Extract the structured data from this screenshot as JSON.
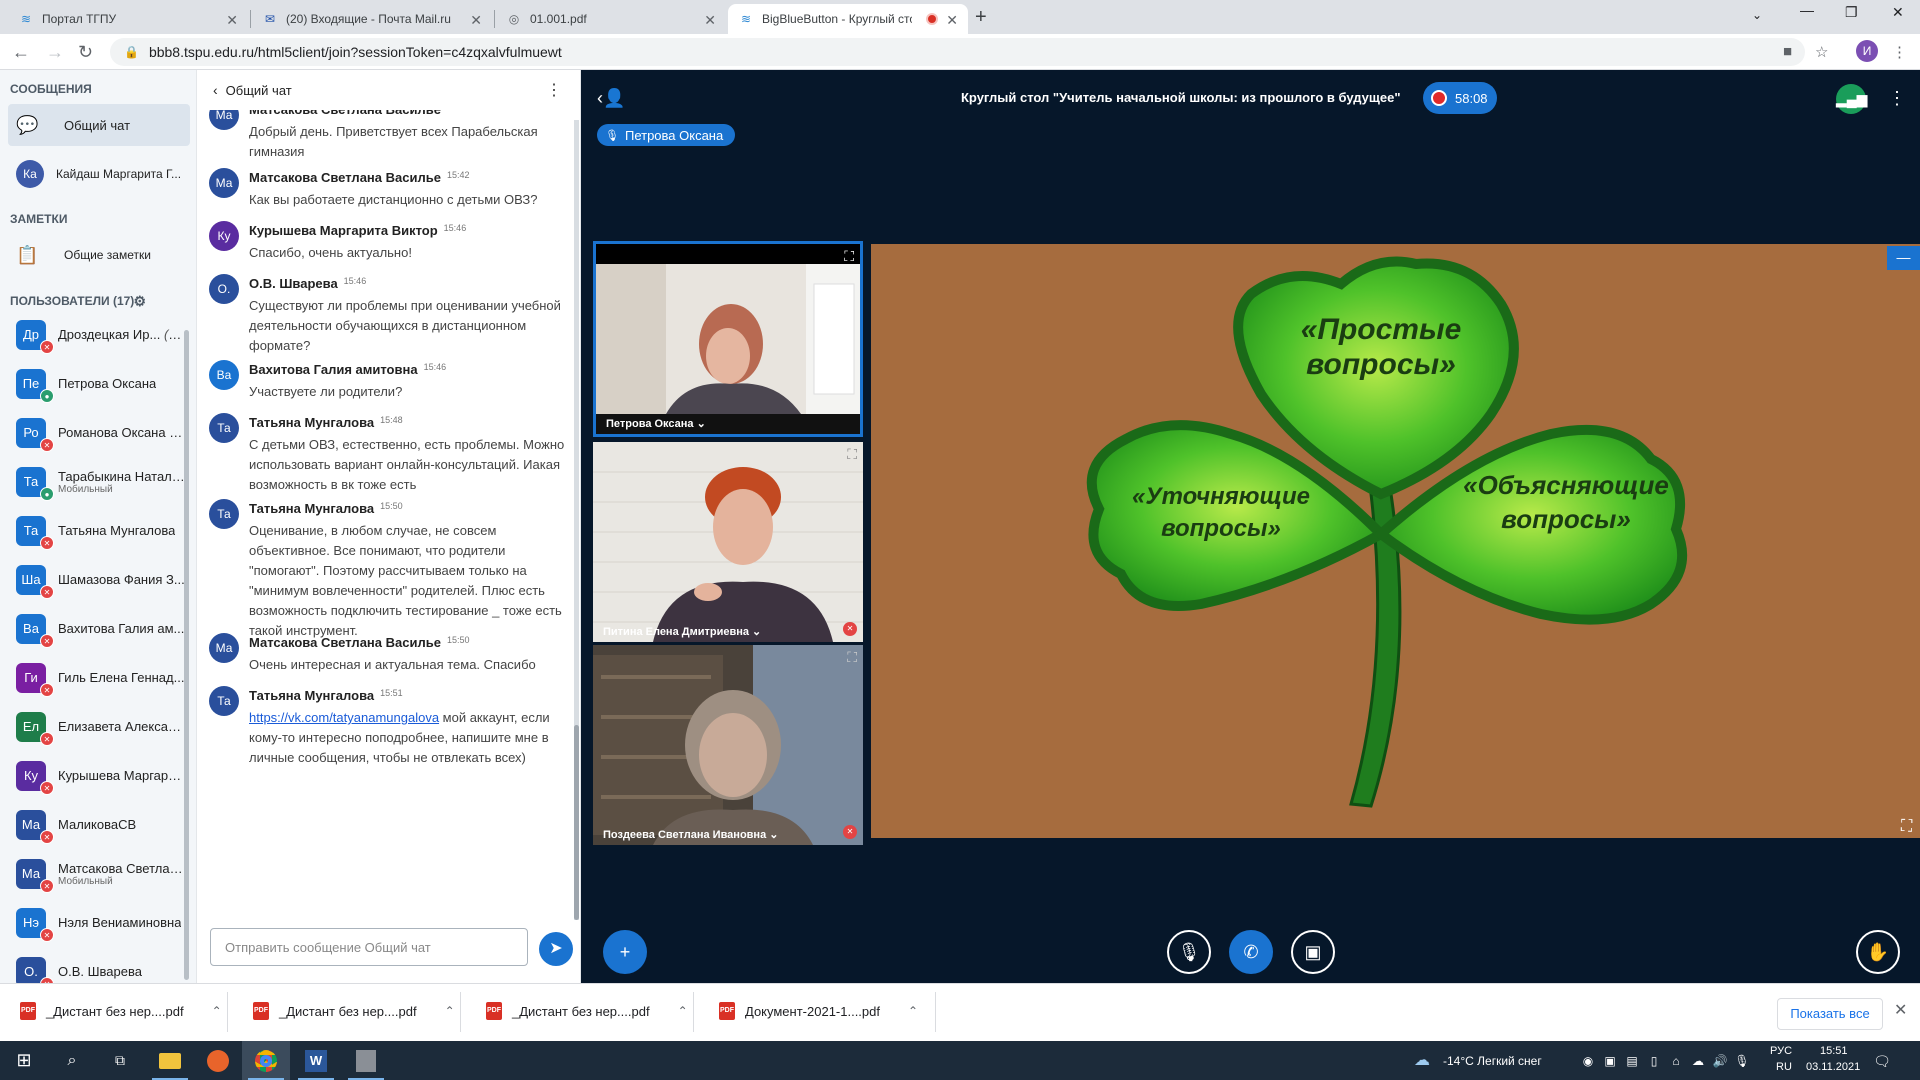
{
  "browser": {
    "tabs": [
      {
        "title": "Портал ТГПУ"
      },
      {
        "title": "(20) Входящие - Почта Mail.ru"
      },
      {
        "title": "01.001.pdf"
      },
      {
        "title": "BigBlueButton - Круглый сто"
      }
    ],
    "url": "bbb8.tspu.edu.ru/html5client/join?sessionToken=c4zqxalvfulmuewt",
    "profile_initial": "И"
  },
  "sidebar": {
    "messages_title": "СООБЩЕНИЯ",
    "public_chat": "Общий чат",
    "private_chat": {
      "initials": "Ка",
      "name": "Кайдаш Маргарита Г..."
    },
    "notes_title": "ЗАМЕТКИ",
    "shared_notes": "Общие заметки",
    "users_title": "ПОЛЬЗОВАТЕЛИ (17)",
    "users": [
      {
        "initials": "Др",
        "name": "Дроздецкая Ир...",
        "you": "(Вы)",
        "sub": "",
        "color": "#1a73d0",
        "mic": "off"
      },
      {
        "initials": "Пе",
        "name": "Петрова Оксана",
        "you": "",
        "sub": "",
        "color": "#1a73d0",
        "mic": "on"
      },
      {
        "initials": "Ро",
        "name": "Романова Оксана Е...",
        "you": "",
        "sub": "",
        "color": "#1a73d0",
        "mic": "off"
      },
      {
        "initials": "Та",
        "name": "Тарабыкина Наталья",
        "you": "",
        "sub": "Мобильный",
        "color": "#1a73d0",
        "mic": "on"
      },
      {
        "initials": "Та",
        "name": "Татьяна Мунгалова",
        "you": "",
        "sub": "",
        "color": "#1a73d0",
        "mic": "off"
      },
      {
        "initials": "Ша",
        "name": "Шамазова Фания З...",
        "you": "",
        "sub": "",
        "color": "#1a73d0",
        "mic": "off"
      },
      {
        "initials": "Ва",
        "name": "Вахитова Галия ам...",
        "you": "",
        "sub": "",
        "color": "#1a73d0",
        "mic": "off"
      },
      {
        "initials": "Ги",
        "name": "Гиль Елена Геннад...",
        "you": "",
        "sub": "",
        "color": "#7a1fa2",
        "mic": "off"
      },
      {
        "initials": "Ел",
        "name": "Елизавета Алексан...",
        "you": "",
        "sub": "",
        "color": "#1e7d4a",
        "mic": "off"
      },
      {
        "initials": "Ку",
        "name": "Курышева Маргари...",
        "you": "",
        "sub": "",
        "color": "#5a2ca0",
        "mic": "off"
      },
      {
        "initials": "Ма",
        "name": "МаликоваСВ",
        "you": "",
        "sub": "",
        "color": "#2a4f9c",
        "mic": "off"
      },
      {
        "initials": "Ма",
        "name": "Матсакова Светлан...",
        "you": "",
        "sub": "Мобильный",
        "color": "#2a4f9c",
        "mic": "off"
      },
      {
        "initials": "Нэ",
        "name": "Нэля Вениаминовна",
        "you": "",
        "sub": "",
        "color": "#1a73d0",
        "mic": "off"
      },
      {
        "initials": "О.",
        "name": "О.В. Шварева",
        "you": "",
        "sub": "",
        "color": "#2a4f9c",
        "mic": "off"
      }
    ]
  },
  "chat": {
    "title": "Общий чат",
    "messages": [
      {
        "initials": "Ма",
        "name": "Матсакова Светлана Василье",
        "time": "",
        "text": "Добрый день. Приветствует всех Парабельская гимназия",
        "link": "",
        "color": "#2a4f9c"
      },
      {
        "initials": "Ма",
        "name": "Матсакова Светлана Василье",
        "time": "15:42",
        "text": "Как вы работаете дистанционно с детьми ОВЗ?",
        "link": "",
        "color": "#2a4f9c"
      },
      {
        "initials": "Ку",
        "name": "Курышева Маргарита Виктор",
        "time": "15:46",
        "text": "Спасибо, очень актуально!",
        "link": "",
        "color": "#5a2ca0"
      },
      {
        "initials": "О.",
        "name": "О.В. Шварева",
        "time": "15:46",
        "text": "Существуют ли проблемы при оценивании учебной деятельности обучающихся в дистанционном формате?",
        "link": "",
        "color": "#2a4f9c"
      },
      {
        "initials": "Ва",
        "name": "Вахитова Галия амитовна",
        "time": "15:46",
        "text": "Участвуете ли родители?",
        "link": "",
        "color": "#1a73d0"
      },
      {
        "initials": "Та",
        "name": "Татьяна Мунгалова",
        "time": "15:48",
        "text": "С детьми ОВЗ, естественно, есть проблемы. Можно использовать вариант онлайн-консультаций. Иакая возможность в вк тоже есть",
        "link": "",
        "color": "#2a4f9c"
      },
      {
        "initials": "Та",
        "name": "Татьяна Мунгалова",
        "time": "15:50",
        "text": "Оценивание, в любом случае, не совсем объективное. Все понимают, что родители \"помогают\". Поэтому рассчитываем только на \"минимум вовлеченности\" родителей. Плюс есть возможность подключить тестирование _ тоже есть такой инструмент.",
        "link": "",
        "color": "#2a4f9c"
      },
      {
        "initials": "Ма",
        "name": "Матсакова Светлана Василье",
        "time": "15:50",
        "text": "Очень интересная и актуальная тема. Спасибо",
        "link": "",
        "color": "#2a4f9c"
      },
      {
        "initials": "Та",
        "name": "Татьяна Мунгалова",
        "time": "15:51",
        "text": " мой аккаунт, если кому-то интересно поподробнее, напишите мне в личные сообщения, чтобы не отвлекать всех)",
        "link": "https://vk.com/tatyanamungalova",
        "color": "#2a4f9c"
      }
    ],
    "input_placeholder": "Отправить сообщение Общий чат"
  },
  "meeting": {
    "title": "Круглый стол \"Учитель начальной школы: из прошлого в будущее\"",
    "timer": "58:08",
    "talking": "Петрова Оксана",
    "videos": [
      {
        "name": "Петрова Оксана"
      },
      {
        "name": "Питина Елена Дмитриевна"
      },
      {
        "name": "Поздеева Светлана Ивановна"
      }
    ],
    "slide": {
      "top_text_1": "«Простые",
      "top_text_2": "вопросы»",
      "left_text_1": "«Уточняющие",
      "left_text_2": "вопросы»",
      "right_text_1": "«Объясняющие",
      "right_text_2": "вопросы»"
    }
  },
  "downloads": {
    "items": [
      {
        "name": "_Дистант без нер....pdf"
      },
      {
        "name": "_Дистант без нер....pdf"
      },
      {
        "name": "_Дистант без нер....pdf"
      },
      {
        "name": "Документ-2021-1....pdf"
      }
    ],
    "show_all": "Показать все"
  },
  "taskbar": {
    "weather": "-14°C  Легкий снег",
    "lang_1": "РУС",
    "lang_2": "RU",
    "time": "15:51",
    "date": "03.11.2021"
  }
}
